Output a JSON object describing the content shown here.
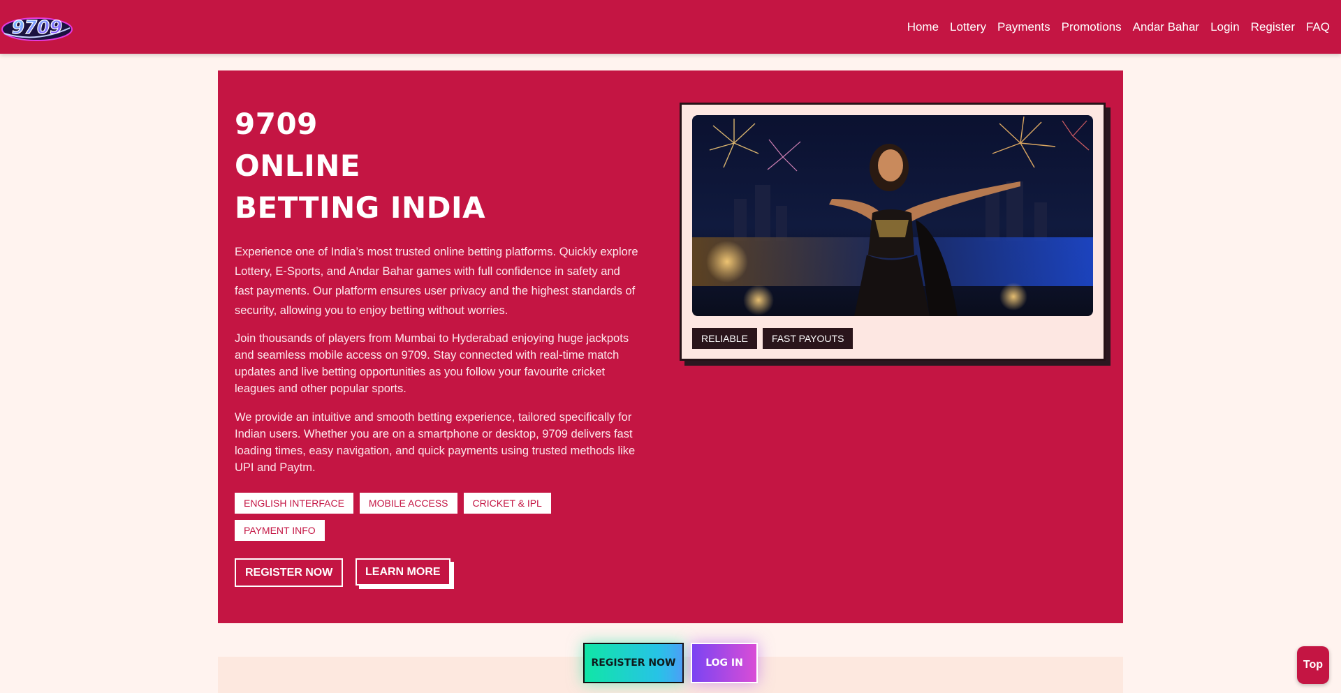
{
  "brand": {
    "logo_text": "9709"
  },
  "nav": {
    "items": [
      {
        "label": "Home",
        "name": "nav-home"
      },
      {
        "label": "Lottery",
        "name": "nav-lottery"
      },
      {
        "label": "Payments",
        "name": "nav-payments"
      },
      {
        "label": "Promotions",
        "name": "nav-promotions"
      },
      {
        "label": "Andar Bahar",
        "name": "nav-andar-bahar"
      },
      {
        "label": "Login",
        "name": "nav-login"
      },
      {
        "label": "Register",
        "name": "nav-register"
      },
      {
        "label": "FAQ",
        "name": "nav-faq"
      }
    ]
  },
  "hero": {
    "title_lines": [
      "9709",
      "ONLINE",
      "BETTING INDIA"
    ],
    "paragraphs": [
      "Experience one of India’s most trusted online betting platforms. Quickly explore Lottery, E-Sports, and Andar Bahar games with full confidence in safety and fast payments. Our platform ensures user privacy and the highest standards of security, allowing you to enjoy betting without worries.",
      "Join thousands of players from Mumbai to Hyderabad enjoying huge jackpots and seamless mobile access on 9709. Stay connected with real-time match updates and live betting opportunities as you follow your favourite cricket leagues and other popular sports.",
      "We provide an intuitive and smooth betting experience, tailored specifically for Indian users. Whether you are on a smartphone or desktop, 9709 delivers fast loading times, easy navigation, and quick payments using trusted methods like UPI and Paytm."
    ],
    "chips": [
      "ENGLISH INTERFACE",
      "MOBILE ACCESS",
      "CRICKET & IPL",
      "PAYMENT INFO"
    ],
    "register_label": "REGISTER NOW",
    "learn_more_label": "LEARN MORE"
  },
  "card": {
    "tags": [
      "RELIABLE",
      "FAST PAYOUTS"
    ]
  },
  "floating": {
    "register_label": "REGISTER NOW",
    "login_label": "LOG IN",
    "top_label": "Top"
  },
  "colors": {
    "brand": "#c41543",
    "background": "#fff3ef",
    "card_bg": "#fde7e2",
    "dark_tag": "#2a151b"
  }
}
